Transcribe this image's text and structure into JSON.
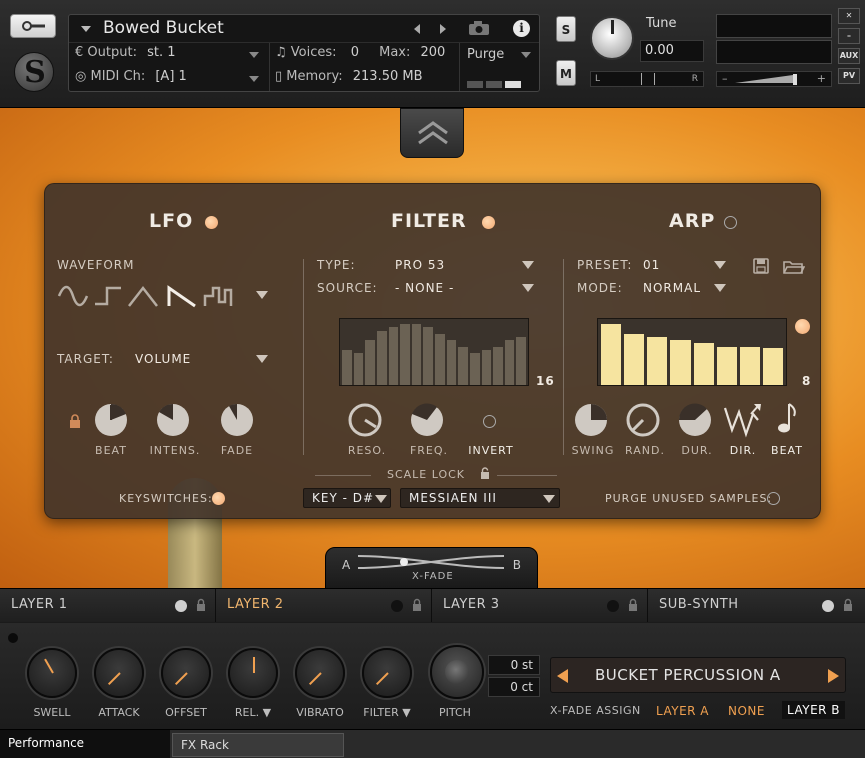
{
  "header": {
    "instrument_title": "Bowed Bucket",
    "output_label": "Output:",
    "output_value": "st. 1",
    "midi_label": "MIDI Ch:",
    "midi_value": "[A]  1",
    "voices_label": "Voices:",
    "voices_value": "0",
    "max_label": "Max:",
    "max_value": "200",
    "memory_label": "Memory:",
    "memory_value": "213.50 MB",
    "purge_label": "Purge",
    "solo_label": "S",
    "mute_label": "M",
    "tune_label": "Tune",
    "tune_value": "0.00",
    "pan_left": "L",
    "pan_right": "R",
    "aux_label": "AUX",
    "pv_label": "PV",
    "close_label": "✕",
    "minimize_label": "–",
    "vol_minus": "–",
    "vol_plus": "+"
  },
  "lfo": {
    "title": "LFO",
    "enabled": true,
    "waveform_label": "WAVEFORM",
    "target_label": "TARGET:",
    "target_value": "VOLUME",
    "knobs": [
      {
        "label": "BEAT"
      },
      {
        "label": "INTENS."
      },
      {
        "label": "FADE"
      }
    ]
  },
  "filter": {
    "title": "FILTER",
    "enabled": true,
    "type_label": "TYPE:",
    "type_value": "PRO 53",
    "source_label": "SOURCE:",
    "source_value": "- NONE -",
    "steps_value": "16",
    "step_values": [
      0.55,
      0.5,
      0.7,
      0.85,
      0.9,
      0.95,
      0.95,
      0.9,
      0.8,
      0.7,
      0.6,
      0.5,
      0.55,
      0.6,
      0.7,
      0.75
    ],
    "knobs": [
      {
        "label": "RESO."
      },
      {
        "label": "FREQ."
      }
    ],
    "invert_label": "INVERT",
    "scale_lock_label": "SCALE LOCK",
    "key_value": "KEY - D#",
    "scale_value": "MESSIAEN III"
  },
  "arp": {
    "title": "ARP",
    "enabled": false,
    "preset_label": "PRESET:",
    "preset_value": "01",
    "mode_label": "MODE:",
    "mode_value": "NORMAL",
    "steps_value": "8",
    "step_values": [
      0.95,
      0.8,
      0.75,
      0.7,
      0.65,
      0.6,
      0.6,
      0.58
    ],
    "knobs": [
      {
        "label": "SWING"
      },
      {
        "label": "RAND."
      },
      {
        "label": "DUR."
      }
    ],
    "dir_label": "DIR.",
    "beat_label": "BEAT"
  },
  "keyswitches_label": "KEYSWITCHES:",
  "purge_unused_label": "PURGE UNUSED SAMPLES:",
  "xfade": {
    "a": "A",
    "b": "B",
    "label": "X-FADE"
  },
  "layers": [
    {
      "label": "LAYER 1",
      "active": false
    },
    {
      "label": "LAYER 2",
      "active": true
    },
    {
      "label": "LAYER 3",
      "active": false
    },
    {
      "label": "SUB-SYNTH",
      "active": false
    }
  ],
  "performance": {
    "knobs": [
      {
        "label": "SWELL"
      },
      {
        "label": "ATTACK"
      },
      {
        "label": "OFFSET"
      },
      {
        "label": "REL. ▼"
      },
      {
        "label": "VIBRATO"
      },
      {
        "label": "FILTER ▼"
      },
      {
        "label": "PITCH"
      }
    ],
    "semitone_value": "0 st",
    "cent_value": "0 ct",
    "preset_name": "BUCKET PERCUSSION A",
    "xfade_assign_label": "X-FADE ASSIGN",
    "xfade_assign_options": [
      "LAYER A",
      "NONE",
      "LAYER B"
    ]
  },
  "bottom_tabs": {
    "performance": "Performance",
    "fx_rack": "FX Rack"
  },
  "colors": {
    "accent": "#f2a872",
    "preset_arrow": "#f0a050",
    "arp_bars": "#f6e4a0"
  }
}
